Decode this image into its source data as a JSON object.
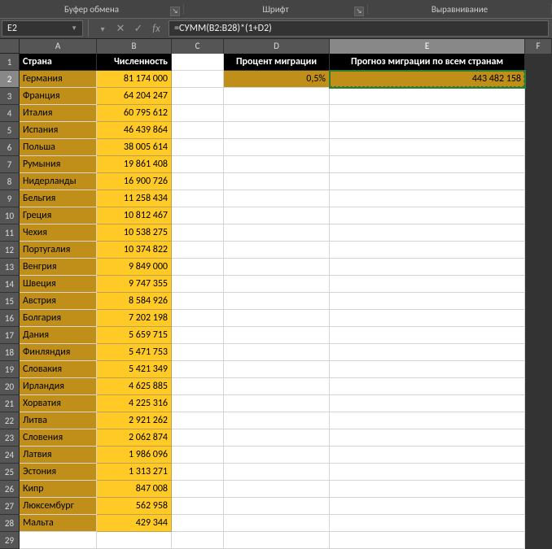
{
  "ribbon": {
    "group1": "Буфер обмена",
    "group2": "Шрифт",
    "group3": "Выравнивание"
  },
  "formula_bar": {
    "name_box": "E2",
    "cancel_icon": "✕",
    "enter_icon": "✓",
    "fx_label": "fx",
    "formula": "=СУММ(B2:B28)*(1+D2)"
  },
  "columns": [
    "A",
    "B",
    "C",
    "D",
    "E",
    "F"
  ],
  "headers": {
    "country": "Страна",
    "population": "Численность",
    "migration_pct": "Процент миграции",
    "forecast": "Прогноз миграции по всем странам"
  },
  "d2": "0,5%",
  "e2": "443 482 158",
  "rows": [
    {
      "n": "2",
      "c": "Германия",
      "p": "81 174 000"
    },
    {
      "n": "3",
      "c": "Франция",
      "p": "64 204 247"
    },
    {
      "n": "4",
      "c": "Италия",
      "p": "60 795 612"
    },
    {
      "n": "5",
      "c": "Испания",
      "p": "46 439 864"
    },
    {
      "n": "6",
      "c": "Польша",
      "p": "38 005 614"
    },
    {
      "n": "7",
      "c": "Румыния",
      "p": "19 861 408"
    },
    {
      "n": "8",
      "c": "Нидерланды",
      "p": "16 900 726"
    },
    {
      "n": "9",
      "c": "Бельгия",
      "p": "11 258 434"
    },
    {
      "n": "10",
      "c": "Греция",
      "p": "10 812 467"
    },
    {
      "n": "11",
      "c": "Чехия",
      "p": "10 538 275"
    },
    {
      "n": "12",
      "c": "Португалия",
      "p": "10 374 822"
    },
    {
      "n": "13",
      "c": "Венгрия",
      "p": "9 849 000"
    },
    {
      "n": "14",
      "c": "Швеция",
      "p": "9 747 355"
    },
    {
      "n": "15",
      "c": "Австрия",
      "p": "8 584 926"
    },
    {
      "n": "16",
      "c": "Болгария",
      "p": "7 202 198"
    },
    {
      "n": "17",
      "c": "Дания",
      "p": "5 659 715"
    },
    {
      "n": "18",
      "c": "Финляндия",
      "p": "5 471 753"
    },
    {
      "n": "19",
      "c": "Словакия",
      "p": "5 421 349"
    },
    {
      "n": "20",
      "c": "Ирландия",
      "p": "4 625 885"
    },
    {
      "n": "21",
      "c": "Хорватия",
      "p": "4 225 316"
    },
    {
      "n": "22",
      "c": "Литва",
      "p": "2 921 262"
    },
    {
      "n": "23",
      "c": "Словения",
      "p": "2 062 874"
    },
    {
      "n": "24",
      "c": "Латвия",
      "p": "1 986 096"
    },
    {
      "n": "25",
      "c": "Эстония",
      "p": "1 313 271"
    },
    {
      "n": "26",
      "c": "Кипр",
      "p": "847 008"
    },
    {
      "n": "27",
      "c": "Люксембург",
      "p": "562 958"
    },
    {
      "n": "28",
      "c": "Мальта",
      "p": "429 344"
    }
  ],
  "empty_row": "29"
}
